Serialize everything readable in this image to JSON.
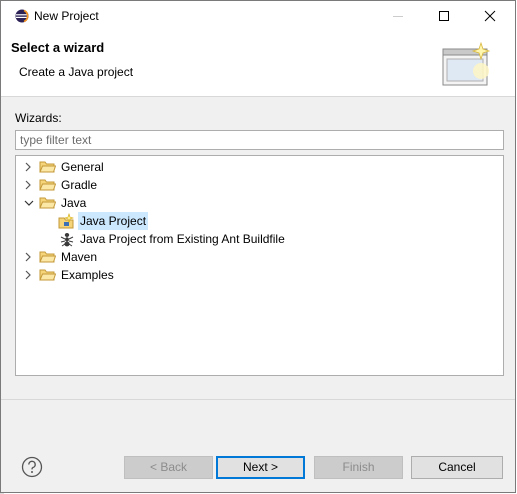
{
  "window": {
    "title": "New Project"
  },
  "header": {
    "title": "Select a wizard",
    "description": "Create a Java project"
  },
  "wizards": {
    "label": "Wizards:",
    "filter_placeholder": "type filter text",
    "tree": {
      "general": "General",
      "gradle": "Gradle",
      "java": "Java",
      "java_project": "Java Project",
      "java_project_ant": "Java Project from Existing Ant Buildfile",
      "maven": "Maven",
      "examples": "Examples"
    }
  },
  "buttons": {
    "back": "< Back",
    "next": "Next >",
    "finish": "Finish",
    "cancel": "Cancel"
  },
  "icons": {
    "app": "eclipse-icon",
    "folder": "folder-icon",
    "java_project": "java-project-icon",
    "ant": "ant-icon",
    "help": "help-icon"
  },
  "colors": {
    "accent": "#0078d7",
    "selection": "#cce8ff",
    "folder": "#e8c26a"
  }
}
